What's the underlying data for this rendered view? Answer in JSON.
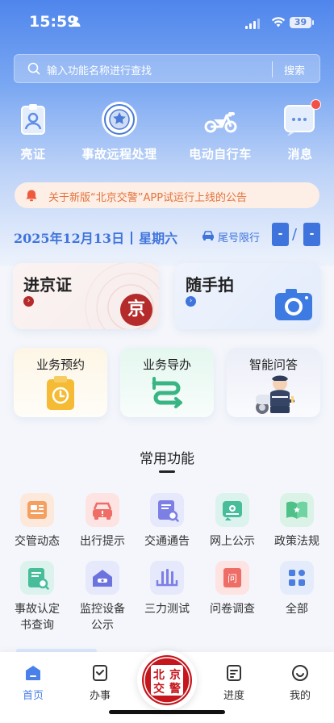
{
  "status_bar": {
    "time": "15:59",
    "battery": "39"
  },
  "search": {
    "placeholder": "输入功能名称进行查找",
    "button_label": "搜索"
  },
  "shortcuts": [
    {
      "label": "亮证",
      "icon": "id-badge-icon"
    },
    {
      "label": "事故远程处理",
      "icon": "police-emblem-icon"
    },
    {
      "label": "电动自行车",
      "icon": "e-bike-icon"
    },
    {
      "label": "消息",
      "icon": "message-icon"
    }
  ],
  "notice": {
    "text": "关于新版“北京交警”APP试运行上线的公告"
  },
  "date_bar": {
    "date": "2025年12月13日",
    "weekday": "星期六",
    "limit_label": "尾号限行",
    "limit_values": [
      "-",
      "-"
    ],
    "separator": "/"
  },
  "big_cards": [
    {
      "title": "进京证",
      "badge": "京",
      "accent": "#b52b2b"
    },
    {
      "title": "随手拍",
      "accent": "#3f74dd"
    }
  ],
  "tiles": [
    {
      "label": "业务预约"
    },
    {
      "label": "业务导办"
    },
    {
      "label": "智能问答"
    }
  ],
  "common": {
    "title": "常用功能",
    "items": [
      {
        "label": "交管动态",
        "icon": "news-icon"
      },
      {
        "label": "出行提示",
        "icon": "car-alert-icon"
      },
      {
        "label": "交通通告",
        "icon": "notice-search-icon"
      },
      {
        "label": "网上公示",
        "icon": "publicity-icon"
      },
      {
        "label": "政策法规",
        "icon": "law-book-icon"
      },
      {
        "label": "事故认定书查询",
        "icon": "accident-doc-icon"
      },
      {
        "label": "监控设备公示",
        "icon": "camera-monitor-icon"
      },
      {
        "label": "三力测试",
        "icon": "test-icon"
      },
      {
        "label": "问卷调查",
        "icon": "survey-icon"
      },
      {
        "label": "全部",
        "icon": "grid-all-icon"
      }
    ]
  },
  "tabbar": {
    "items": [
      {
        "label": "首页",
        "active": true
      },
      {
        "label": "办事"
      },
      {
        "label": "进度"
      },
      {
        "label": "我的"
      }
    ],
    "center_logo_text": "北京交警",
    "active_color": "#4a80ea"
  },
  "colors": {
    "brand_blue": "#3f74dd",
    "notice_orange": "#e3743d",
    "alert_red": "#f25044"
  }
}
